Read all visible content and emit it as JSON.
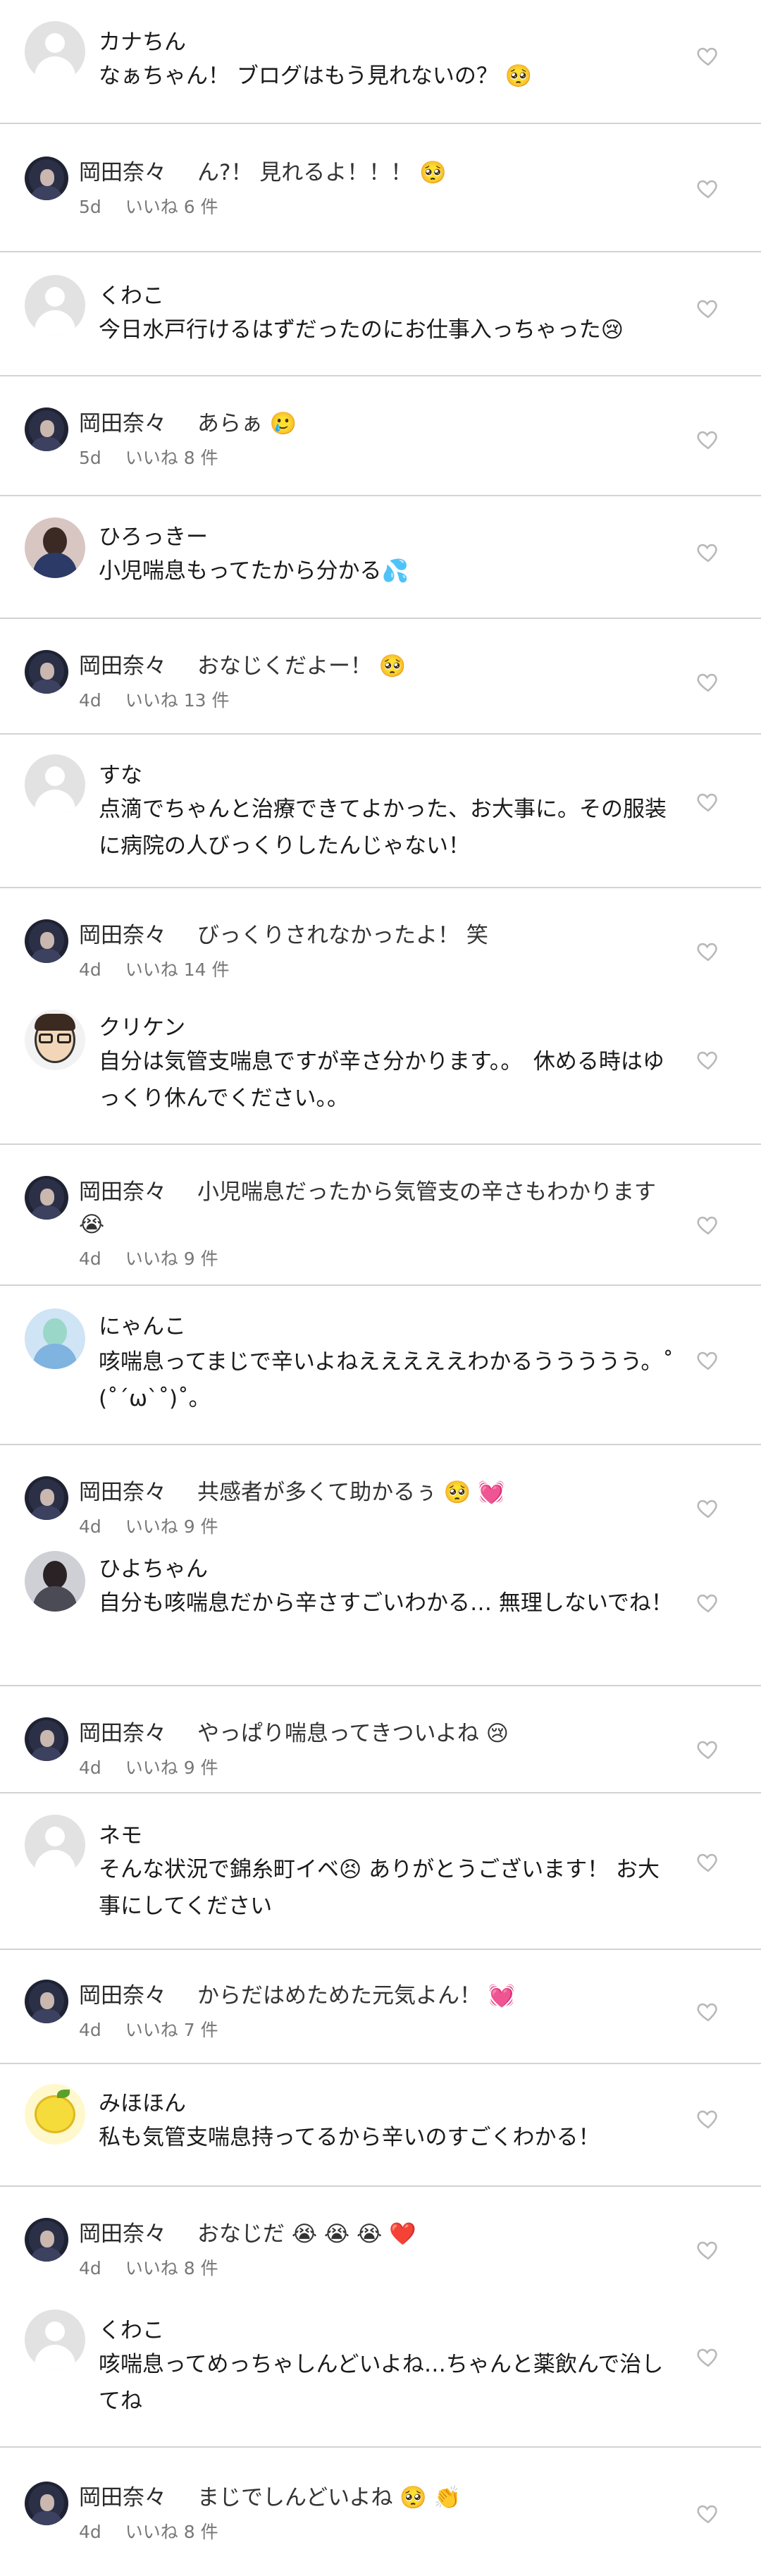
{
  "comments": [
    {
      "name": "カナちん",
      "text": "なぁちゃん！ ブログはもう見れないの？ 🥺",
      "avatar": "default"
    },
    {
      "name": "くわこ",
      "text": "今日水戸行けるはずだったのにお仕事入っちゃった😢",
      "avatar": "default"
    },
    {
      "name": "ひろっきー",
      "text": "小児喘息もってたから分かる💦",
      "avatar": "photo-girl"
    },
    {
      "name": "すな",
      "text": "点滴でちゃんと治療できてよかった、お大事に。その服装に病院の人びっくりしたんじゃない！",
      "avatar": "default"
    },
    {
      "name": "クリケン",
      "text": "自分は気管支喘息ですが辛さ分かります。。　休める時はゆっくり休んでください。。",
      "avatar": "glasses"
    },
    {
      "name": "にゃんこ",
      "text": "咳喘息ってまじで辛いよねえええええわかるううううう。˚ (˚´ω`˚)˚。",
      "avatar": "anime"
    },
    {
      "name": "ひよちゃん",
      "text": "自分も咳喘息だから辛さすごいわかる… 無理しないでね！",
      "avatar": "photo-dark"
    },
    {
      "name": "ネモ",
      "text": "そんな状況で錦糸町イベ😣 ありがとうございます！ お大事にしてください",
      "avatar": "default"
    },
    {
      "name": "みほほん",
      "text": "私も気管支喘息持ってるから辛いのすごくわかる！",
      "avatar": "lemon"
    },
    {
      "name": "くわこ",
      "text": "咳喘息ってめっちゃしんどいよね…ちゃんと薬飲んで治してね",
      "avatar": "default"
    }
  ],
  "replies": [
    {
      "name": "岡田奈々",
      "text": "ん?！ 見れるよ！！！ 🥺",
      "age": "5d",
      "likes": "いいね 6 件"
    },
    {
      "name": "岡田奈々",
      "text": "あらぁ 🥲",
      "age": "5d",
      "likes": "いいね 8 件"
    },
    {
      "name": "岡田奈々",
      "text": "おなじくだよー！ 🥺",
      "age": "4d",
      "likes": "いいね 13 件"
    },
    {
      "name": "岡田奈々",
      "text": "びっくりされなかったよ！ 笑",
      "age": "4d",
      "likes": "いいね 14 件"
    },
    {
      "name": "岡田奈々",
      "text": "小児喘息だったから気管支の辛さもわかります 😭",
      "age": "4d",
      "likes": "いいね 9 件"
    },
    {
      "name": "岡田奈々",
      "text": "共感者が多くて助かるぅ 🥺 💓",
      "age": "4d",
      "likes": "いいね 9 件"
    },
    {
      "name": "岡田奈々",
      "text": "やっぱり喘息ってきついよね 😢",
      "age": "4d",
      "likes": "いいね 9 件"
    },
    {
      "name": "岡田奈々",
      "text": "からだはめためた元気よん！ 💓",
      "age": "4d",
      "likes": "いいね 7 件"
    },
    {
      "name": "岡田奈々",
      "text": "おなじだ 😭 😭 😭 ❤️",
      "age": "4d",
      "likes": "いいね 8 件"
    },
    {
      "name": "岡田奈々",
      "text": "まじでしんどいよね 🥺 👏",
      "age": "4d",
      "likes": "いいね 8 件"
    }
  ],
  "icons": {
    "like": "heart-outline-icon",
    "avatar_default": "default-avatar-icon"
  },
  "colors": {
    "separator": "#d3d3d3",
    "meta": "#777777",
    "heart": "#b8b8b8"
  }
}
